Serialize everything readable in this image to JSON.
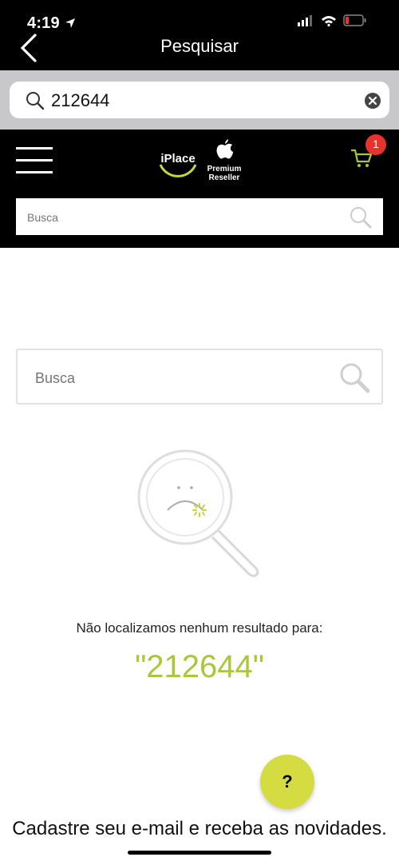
{
  "status_bar": {
    "time": "4:19"
  },
  "nav": {
    "title": "Pesquisar"
  },
  "search": {
    "value": "212644"
  },
  "header": {
    "logo_text": "iPlace",
    "apple_badge": "Premium Reseller",
    "cart_count": "1",
    "search_placeholder": "Busca"
  },
  "main": {
    "search_placeholder": "Busca",
    "no_result_text": "Não localizamos nenhum resultado para:",
    "query_text": "\"212644\"",
    "help_label": "?",
    "newsletter_text": "Cadastre seu e-mail e receba as novidades."
  },
  "colors": {
    "accent": "#a9c73a",
    "help_button": "#d5dc42",
    "badge": "#e8322c"
  }
}
